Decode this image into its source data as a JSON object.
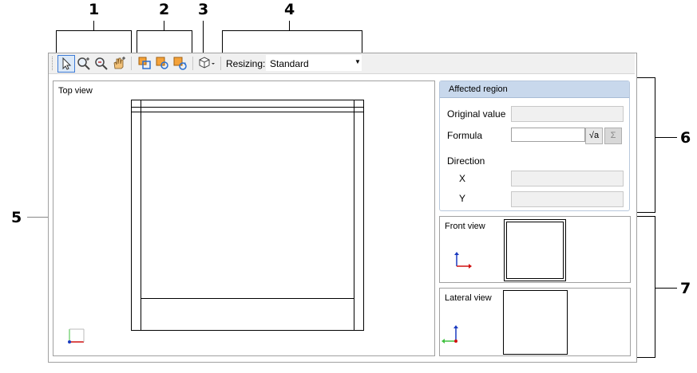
{
  "callouts": [
    "1",
    "2",
    "3",
    "4",
    "5",
    "6",
    "7"
  ],
  "toolbar": {
    "tools": [
      {
        "name": "select-arrow-icon"
      },
      {
        "name": "zoom-in-icon"
      },
      {
        "name": "zoom-out-icon"
      },
      {
        "name": "pan-hand-icon"
      }
    ],
    "views": [
      {
        "name": "view-front-icon"
      },
      {
        "name": "view-rotate-icon"
      },
      {
        "name": "view-reset-icon"
      }
    ],
    "view3d": {
      "name": "cube-3d-icon"
    },
    "resizing_label": "Resizing:",
    "resizing_value": "Standard"
  },
  "top_view": {
    "title": "Top view"
  },
  "affected_region": {
    "title": "Affected region",
    "original_value_label": "Original value",
    "formula_label": "Formula",
    "formula_value": "",
    "direction_label": "Direction",
    "x_label": "X",
    "y_label": "Y",
    "sqrt_button": "√a",
    "sum_button": "Σ"
  },
  "front_view": {
    "title": "Front view"
  },
  "lateral_view": {
    "title": "Lateral view"
  },
  "colors": {
    "header_blue": "#c8d8ec",
    "axis_red": "#d01010",
    "axis_blue": "#1a3ac0",
    "axis_green": "#40c040"
  }
}
